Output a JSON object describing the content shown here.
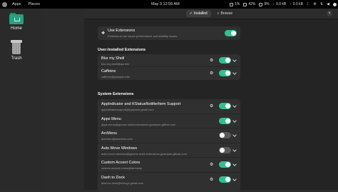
{
  "topbar": {
    "apps": "Apps",
    "places": "Places",
    "clock": "May 3  12:56 AM",
    "stats": [
      "1%",
      "42%",
      "9%",
      "0.0 kB",
      "0.0 kB"
    ]
  },
  "desktop": {
    "home_label": "Home",
    "trash_label": "Trash"
  },
  "window": {
    "tabs": [
      {
        "label": "Installed",
        "icon": "check-icon"
      },
      {
        "label": "Browse",
        "icon": "search-icon"
      }
    ],
    "use_extensions": {
      "title": "Use Extensions",
      "subtitle": "Extensions can cause performance and stability issues.",
      "enabled": true
    },
    "user_section": "User-Installed Extensions",
    "user_extensions": [
      {
        "name": "Blur my Shell",
        "id": "blur-my-shell@aunetx",
        "enabled": true
      },
      {
        "name": "Caffeine",
        "id": "caffeine@patapon.info",
        "enabled": true
      }
    ],
    "system_section": "System Extensions",
    "system_extensions": [
      {
        "name": "AppIndicator and KStatusNotifierItem Support",
        "id": "appindicatorsupport@rgcjonas.gmail.com",
        "enabled": true
      },
      {
        "name": "Apps Menu",
        "id": "apps-menu@gnome-shell-extensions.gcampax.github.com",
        "enabled": true
      },
      {
        "name": "ArcMenu",
        "id": "arcmenu@arcmenu.com",
        "enabled": false
      },
      {
        "name": "Auto Move Windows",
        "id": "auto-move-windows@gnome-shell-extensions.gcampax.github.com",
        "enabled": false
      },
      {
        "name": "Custom Accent Colors",
        "id": "custom-accent-colors@demiskp",
        "enabled": true
      },
      {
        "name": "Dash to Dock",
        "id": "dash-to-dock@micxgx.gmail.com",
        "enabled": true
      }
    ]
  },
  "colors": {
    "accent": "#33bf91",
    "toggle_off": "#5a5a5a"
  }
}
